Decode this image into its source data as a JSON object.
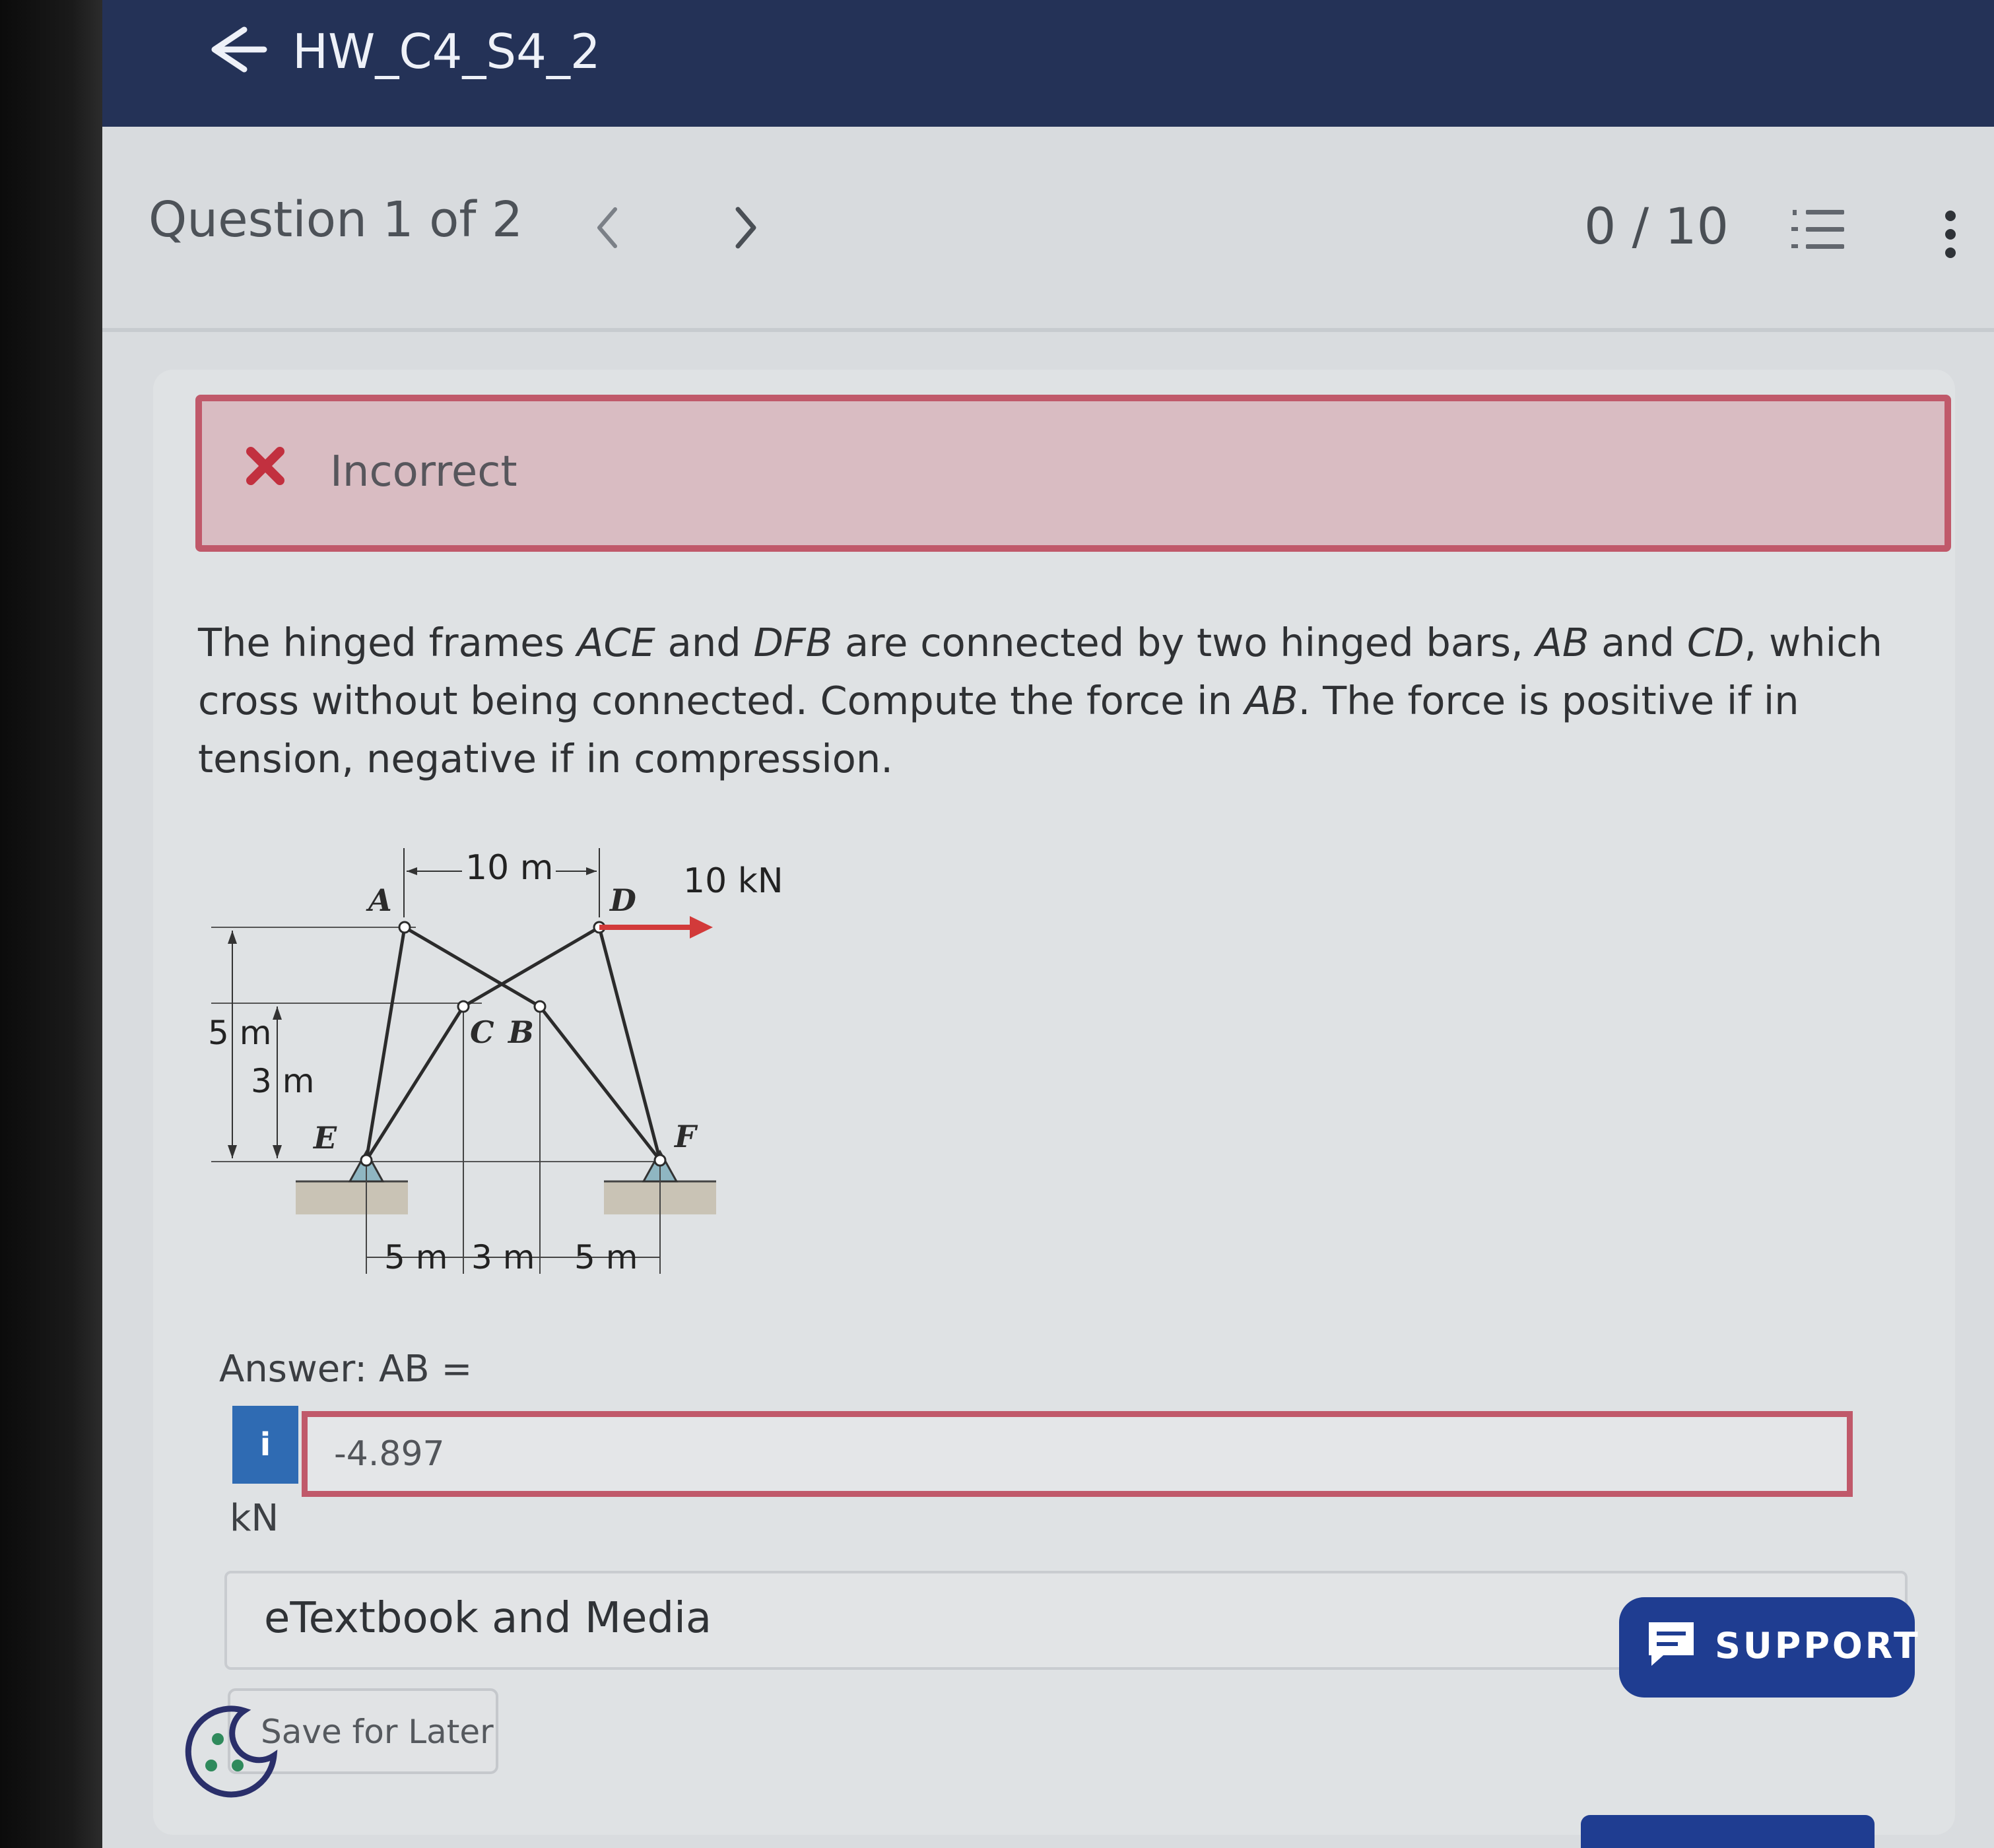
{
  "header": {
    "title": "HW_C4_S4_2"
  },
  "question_nav": {
    "counter": "Question 1 of 2",
    "score": "0 / 10"
  },
  "feedback": {
    "status": "Incorrect"
  },
  "question": {
    "p1": "The hinged frames ",
    "f1": "ACE",
    "p2": " and ",
    "f2": "DFB",
    "p3": " are connected by two hinged bars, ",
    "f3": "AB",
    "p4": " and ",
    "f4": "CD",
    "p5": ", which cross without being connected. Compute the force in ",
    "f5": "AB",
    "p6": ". The force is positive if in tension, negative if in compression."
  },
  "figure": {
    "dim_top": "10 m",
    "load": "10 kN",
    "dim_height_total": "5 m",
    "dim_height_partial": "3 m",
    "dim_bottom_1": "5 m",
    "dim_bottom_2": "3 m",
    "dim_bottom_3": "5 m",
    "label_a": "A",
    "label_d": "D",
    "label_c": "C",
    "label_b": "B",
    "label_e": "E",
    "label_f": "F"
  },
  "answer": {
    "label": "Answer: AB =",
    "info": "i",
    "value": "-4.897",
    "unit": "kN"
  },
  "resources": {
    "etextbook": "eTextbook and Media"
  },
  "actions": {
    "save_later": "Save for Later",
    "support": "SUPPORT"
  }
}
